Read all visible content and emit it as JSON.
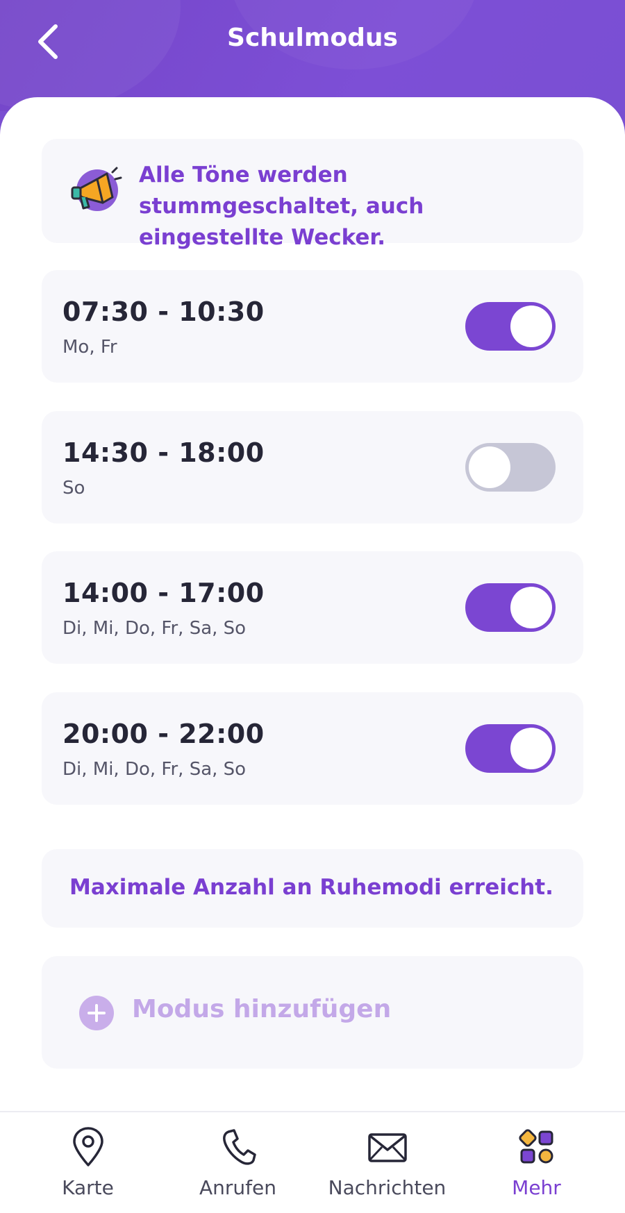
{
  "header": {
    "title": "Schulmodus",
    "back_icon": "chevron-left-icon"
  },
  "info": {
    "text": "Alle Töne werden stummgeschaltet, auch eingestellte Wecker.",
    "icon": "megaphone-icon"
  },
  "modes": [
    {
      "time": "07:30 - 10:30",
      "days": "Mo, Fr",
      "enabled": true
    },
    {
      "time": "14:30 - 18:00",
      "days": "So",
      "enabled": false
    },
    {
      "time": "14:00 - 17:00",
      "days": "Di, Mi, Do, Fr, Sa, So",
      "enabled": true
    },
    {
      "time": "20:00 - 22:00",
      "days": "Di, Mi, Do, Fr, Sa, So",
      "enabled": true
    }
  ],
  "max_notice": "Maximale Anzahl an Ruhemodi erreicht.",
  "add_button": {
    "label": "Modus hinzufügen",
    "icon": "plus-circle-icon"
  },
  "nav": [
    {
      "label": "Karte",
      "icon": "map-pin-icon"
    },
    {
      "label": "Anrufen",
      "icon": "phone-icon"
    },
    {
      "label": "Nachrichten",
      "icon": "envelope-icon"
    },
    {
      "label": "Mehr",
      "icon": "apps-grid-icon",
      "active": true
    }
  ],
  "colors": {
    "accent": "#7a3fd1",
    "toggle_on": "#7b46d2",
    "toggle_off": "#c6c6d6",
    "card_bg": "#f7f7fb"
  }
}
